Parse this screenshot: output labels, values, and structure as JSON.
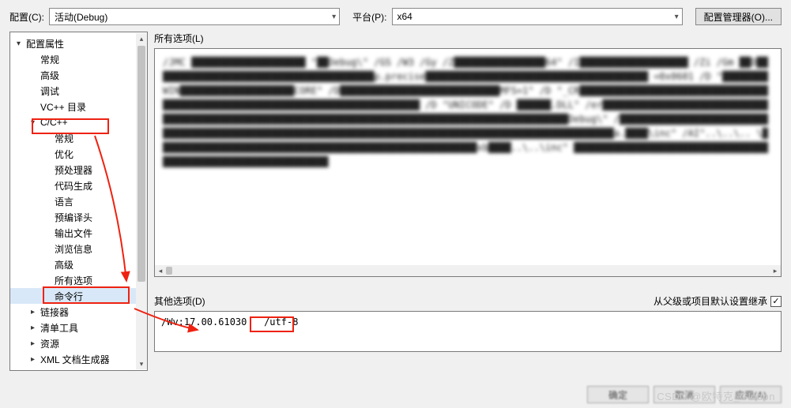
{
  "toolbar": {
    "config_label": "配置(C):",
    "config_value": "活动(Debug)",
    "platform_label": "平台(P):",
    "platform_value": "x64",
    "manager_button": "配置管理器(O)..."
  },
  "tree": {
    "items": [
      {
        "label": "配置属性",
        "depth": 0,
        "expander": "▾",
        "selected": false
      },
      {
        "label": "常规",
        "depth": 1,
        "expander": "",
        "selected": false
      },
      {
        "label": "高级",
        "depth": 1,
        "expander": "",
        "selected": false
      },
      {
        "label": "调试",
        "depth": 1,
        "expander": "",
        "selected": false
      },
      {
        "label": "VC++ 目录",
        "depth": 1,
        "expander": "",
        "selected": false
      },
      {
        "label": "C/C++",
        "depth": 1,
        "expander": "▾",
        "selected": false
      },
      {
        "label": "常规",
        "depth": 2,
        "expander": "",
        "selected": false
      },
      {
        "label": "优化",
        "depth": 2,
        "expander": "",
        "selected": false
      },
      {
        "label": "预处理器",
        "depth": 2,
        "expander": "",
        "selected": false
      },
      {
        "label": "代码生成",
        "depth": 2,
        "expander": "",
        "selected": false
      },
      {
        "label": "语言",
        "depth": 2,
        "expander": "",
        "selected": false
      },
      {
        "label": "预编译头",
        "depth": 2,
        "expander": "",
        "selected": false
      },
      {
        "label": "输出文件",
        "depth": 2,
        "expander": "",
        "selected": false
      },
      {
        "label": "浏览信息",
        "depth": 2,
        "expander": "",
        "selected": false
      },
      {
        "label": "高级",
        "depth": 2,
        "expander": "",
        "selected": false
      },
      {
        "label": "所有选项",
        "depth": 2,
        "expander": "",
        "selected": false
      },
      {
        "label": "命令行",
        "depth": 2,
        "expander": "",
        "selected": true
      },
      {
        "label": "链接器",
        "depth": 1,
        "expander": "▸",
        "selected": false
      },
      {
        "label": "清单工具",
        "depth": 1,
        "expander": "▸",
        "selected": false
      },
      {
        "label": "资源",
        "depth": 1,
        "expander": "▸",
        "selected": false
      },
      {
        "label": "XML 文档生成器",
        "depth": 1,
        "expander": "▸",
        "selected": false
      }
    ]
  },
  "right": {
    "all_options_label": "所有选项(L)",
    "all_options_text": "/JMC ████████████████████ \"██Debug\\\" /GS /W3 /Gy /Z████████████████64\" /I███████████████████ /Zi\n/Gm ██D███████████████████████████████████████p.precise███████████████████████████████████████ =0x0601 /D \"████████WIN████████████████████CORE\" /D████████████████████████████MFS=1\" /D\n\"_CR██████████████████████████████████████████████████████████████████████████████ /D \"UNICODE\" /D ██████.DLL\"\n/er████████████████████████████████████████████████████████████████████████████████████████████████████Debug\\\"\n/█████████████████████████████████████████████████████████████████████████████████████████████████████████a.████\\inc\" /AI\"..\\..\\..\n\\████████████████████████████████████████████████████████xb████..\\..\\inc\" ███████████████████████████████████████████████████████████████",
    "other_options_label": "其他选项(D)",
    "inherit_label": "从父级或项目默认设置继承",
    "inherit_checked": true,
    "other_options_value_1": "/Wv:17.00.61030",
    "other_options_value_2": "/utf-8"
  },
  "buttons": {
    "ok": "确定",
    "cancel": "取消",
    "apply": "应用(A)"
  },
  "watermark": "CSDN @欧特克_Glodon"
}
